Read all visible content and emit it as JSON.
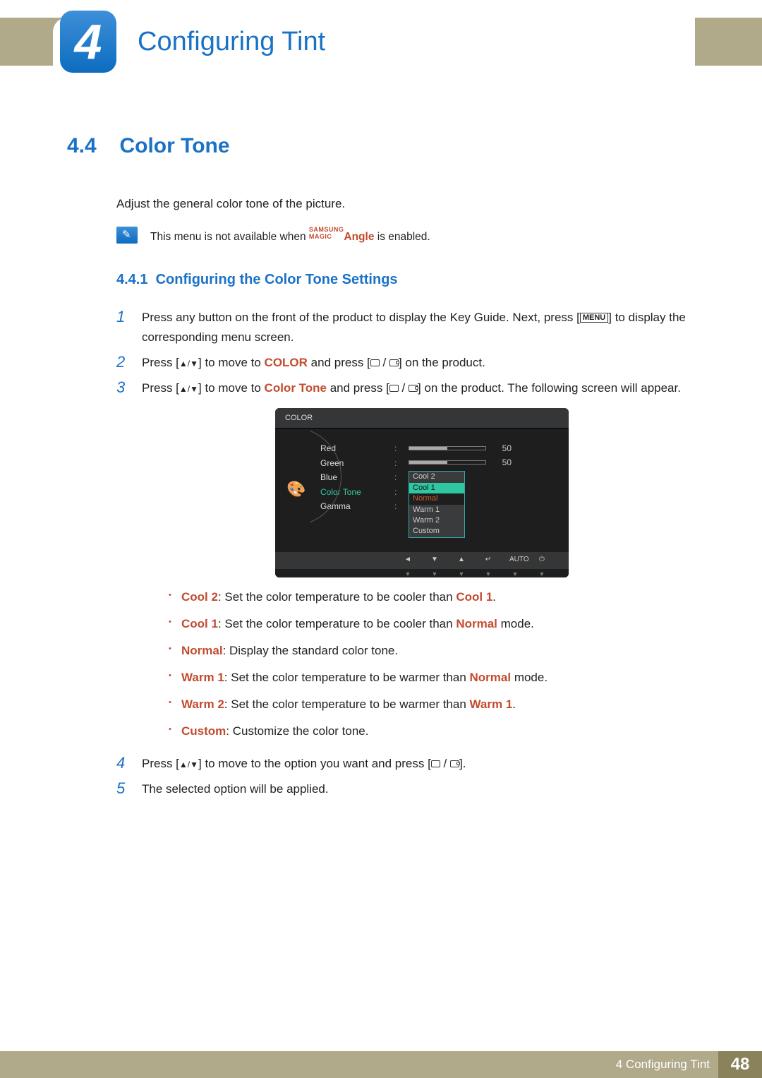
{
  "chapter": {
    "number": "4",
    "title": "Configuring Tint"
  },
  "section": {
    "number": "4.4",
    "title": "Color Tone"
  },
  "description": "Adjust the general color tone of the picture.",
  "note": {
    "prefix": "This menu is not available when ",
    "brand_top": "SAMSUNG",
    "brand_bottom": "MAGIC",
    "feature": "Angle",
    "suffix": " is enabled."
  },
  "subsection": {
    "number": "4.4.1",
    "title": "Configuring the Color Tone Settings"
  },
  "steps": {
    "s1_a": "Press any button on the front of the product to display the Key Guide. Next, press [",
    "s1_menu": "MENU",
    "s1_b": "] to display the corresponding menu screen.",
    "s2_a": "Press [",
    "s2_b": "] to move to ",
    "s2_kw": "COLOR",
    "s2_c": " and press [",
    "s2_d": "] on the product.",
    "s3_a": "Press [",
    "s3_b": "] to move to ",
    "s3_kw": "Color Tone",
    "s3_c": " and press [",
    "s3_d": "] on the product. The following screen will appear.",
    "s4_a": "Press [",
    "s4_b": "] to move to the option you want and press [",
    "s4_c": "].",
    "s5": "The selected option will be applied."
  },
  "osd": {
    "header": "COLOR",
    "rows": {
      "red": {
        "label": "Red",
        "value": "50"
      },
      "green": {
        "label": "Green",
        "value": "50"
      },
      "blue": {
        "label": "Blue"
      },
      "colortone": {
        "label": "Color Tone"
      },
      "gamma": {
        "label": "Gamma"
      }
    },
    "tone_options": [
      "Cool 2",
      "Cool 1",
      "Normal",
      "Warm 1",
      "Warm 2",
      "Custom"
    ],
    "nav": {
      "auto": "AUTO"
    }
  },
  "bullets": {
    "cool2": {
      "kw": "Cool 2",
      "txt": ": Set the color temperature to be cooler than ",
      "ref": "Cool 1",
      "end": "."
    },
    "cool1": {
      "kw": "Cool 1",
      "txt": ": Set the color temperature to be cooler than ",
      "ref": "Normal",
      "end": " mode."
    },
    "normal": {
      "kw": "Normal",
      "txt": ": Display the standard color tone."
    },
    "warm1": {
      "kw": "Warm 1",
      "txt": ": Set the color temperature to be warmer than ",
      "ref": "Normal",
      "end": " mode."
    },
    "warm2": {
      "kw": "Warm 2",
      "txt": ": Set the color temperature to be warmer than ",
      "ref": "Warm 1",
      "end": "."
    },
    "custom": {
      "kw": "Custom",
      "txt": ": Customize the color tone."
    }
  },
  "footer": {
    "label": "4 Configuring Tint",
    "page": "48"
  }
}
